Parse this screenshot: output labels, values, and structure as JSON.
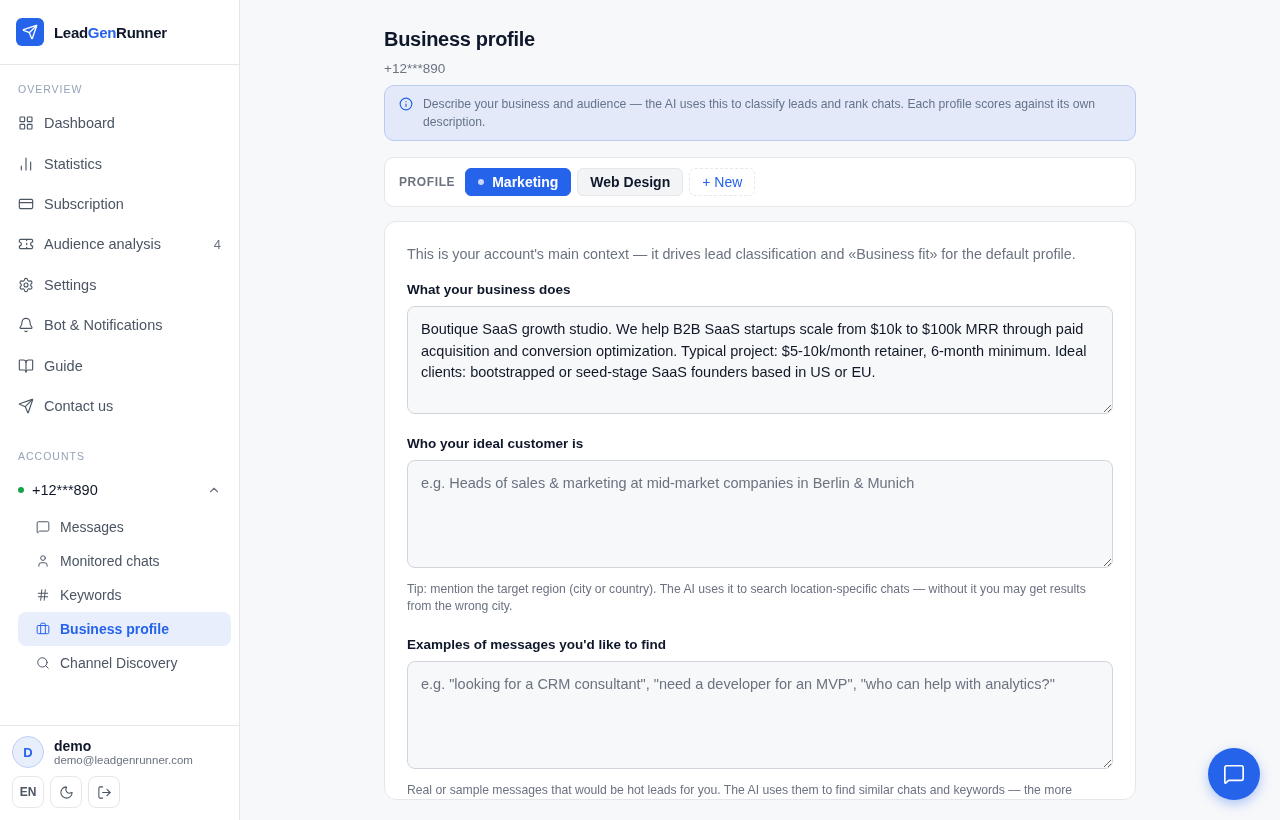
{
  "brand": {
    "parts": [
      {
        "text": "Lead",
        "accent": false
      },
      {
        "text": "Gen",
        "accent": true
      },
      {
        "text": "Runner",
        "accent": false
      }
    ]
  },
  "sidebar": {
    "overview_heading": "OVERVIEW",
    "items": [
      {
        "label": "Dashboard",
        "selected": false
      },
      {
        "label": "Statistics",
        "selected": false
      },
      {
        "label": "Subscription",
        "selected": false
      },
      {
        "label": "Audience analysis",
        "selected": false,
        "badge": "4"
      },
      {
        "label": "Settings",
        "selected": false
      },
      {
        "label": "Bot & Notifications",
        "selected": false
      },
      {
        "label": "Guide",
        "selected": false
      },
      {
        "label": "Contact us",
        "selected": false
      }
    ],
    "accounts_heading": "ACCOUNTS",
    "account": {
      "label": "+12***890",
      "color": "#16a34a",
      "expanded": true,
      "children": [
        {
          "label": "Messages",
          "selected": false
        },
        {
          "label": "Monitored chats",
          "selected": false
        },
        {
          "label": "Keywords",
          "selected": false
        },
        {
          "label": "Business profile",
          "selected": true
        },
        {
          "label": "Channel Discovery",
          "selected": false
        }
      ]
    }
  },
  "user": {
    "initial": "D",
    "name": "demo",
    "email": "demo@leadgenrunner.com",
    "language": "EN"
  },
  "page": {
    "title": "Business profile",
    "subtitle": "+12***890",
    "notice": "Describe your business and audience — the AI uses this to classify leads and rank chats. Each profile scores against its own description.",
    "profile_label": "PROFILE",
    "profiles": [
      {
        "label": "Marketing",
        "selected": true,
        "kind": "profile"
      },
      {
        "label": "Web Design",
        "selected": false,
        "kind": "profile"
      },
      {
        "label": "+ New",
        "selected": false,
        "kind": "new"
      }
    ],
    "intro": "This is your account's main context — it drives lead classification and «Business fit» for the default profile.",
    "fields": [
      {
        "label": "What your business does",
        "value": "Boutique SaaS growth studio. We help B2B SaaS startups scale from $10k to $100k MRR through paid acquisition and conversion optimization. Typical project: $5-10k/month retainer, 6-month minimum. Ideal clients: bootstrapped or seed-stage SaaS founders based in US or EU."
      },
      {
        "label": "Who your ideal customer is",
        "placeholder": "e.g. Heads of sales & marketing at mid-market companies in Berlin & Munich",
        "hint": "Tip: mention the target region (city or country). The AI uses it to search location-specific chats — without it you may get results from the wrong city."
      },
      {
        "label": "Examples of messages you'd like to find",
        "placeholder": "e.g. \"looking for a CRM consultant\", \"need a developer for an MVP\", \"who can help with analytics?\"",
        "hint": "Real or sample messages that would be hot leads for you. The AI uses them to find similar chats and keywords — the more"
      }
    ]
  }
}
